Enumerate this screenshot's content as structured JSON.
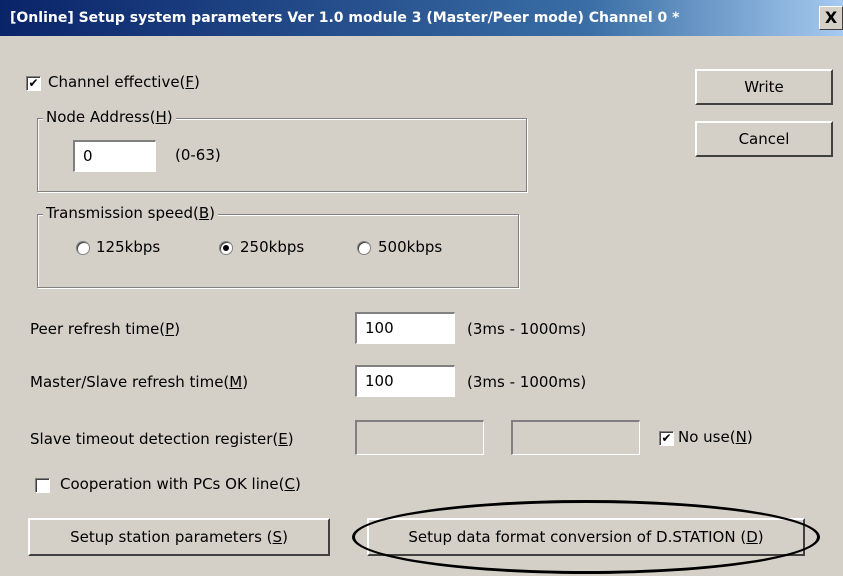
{
  "window": {
    "title": "[Online] Setup system parameters Ver 1.0 module 3 (Master/Peer mode) Channel 0 *",
    "close_glyph": "X"
  },
  "channel_effective": {
    "label": "Channel effective(",
    "mnemonic": "F",
    "suffix": ")",
    "checked": true
  },
  "buttons": {
    "write": "Write",
    "cancel": "Cancel"
  },
  "node_address": {
    "legend_text": "Node Address(",
    "legend_mnemonic": "H",
    "legend_suffix": ")",
    "value": "0",
    "range": "(0-63)"
  },
  "transmission_speed": {
    "legend_text": "Transmission speed(",
    "legend_mnemonic": "B",
    "legend_suffix": ")",
    "options": [
      {
        "label": "125kbps",
        "selected": false
      },
      {
        "label": "250kbps",
        "selected": true
      },
      {
        "label": "500kbps",
        "selected": false
      }
    ]
  },
  "peer_refresh": {
    "label": "Peer refresh time(",
    "mnemonic": "P",
    "suffix": ")",
    "value": "100",
    "range": "(3ms - 1000ms)"
  },
  "ms_refresh": {
    "label": "Master/Slave refresh time(",
    "mnemonic": "M",
    "suffix": ")",
    "value": "100",
    "range": "(3ms - 1000ms)"
  },
  "slave_timeout": {
    "label": "Slave timeout detection register(",
    "mnemonic": "E",
    "suffix": ")",
    "value1": "",
    "value2": "",
    "no_use_label": "No use(",
    "no_use_mnemonic": "N",
    "no_use_suffix": ")",
    "no_use_checked": true
  },
  "cooperation": {
    "label": "Cooperation with PCs OK line(",
    "mnemonic": "C",
    "suffix": ")",
    "checked": false
  },
  "bottom_buttons": {
    "station_params": {
      "label": "Setup station parameters (",
      "mnemonic": "S",
      "suffix": ")"
    },
    "dstation": {
      "label": "Setup data format conversion of D.STATION (",
      "mnemonic": "D",
      "suffix": ")"
    }
  },
  "check_glyph": "✔"
}
